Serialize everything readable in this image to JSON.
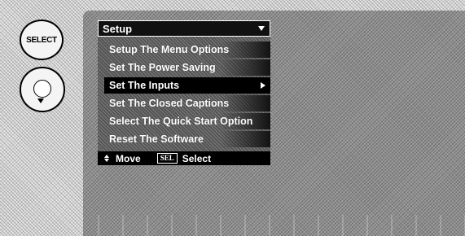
{
  "remote": {
    "select_label": "SELECT"
  },
  "menu": {
    "title": "Setup",
    "items": [
      {
        "label": "Setup The Menu Options",
        "selected": false
      },
      {
        "label": "Set The Power Saving",
        "selected": false
      },
      {
        "label": "Set The Inputs",
        "selected": true,
        "has_submenu": true
      },
      {
        "label": "Set The Closed Captions",
        "selected": false
      },
      {
        "label": "Select The Quick Start Option",
        "selected": false
      },
      {
        "label": "Reset The Software",
        "selected": false
      }
    ],
    "hint": {
      "move_icon": "up-down-arrows-icon",
      "move_label": "Move",
      "select_key": "SEL",
      "select_label": "Select"
    }
  }
}
